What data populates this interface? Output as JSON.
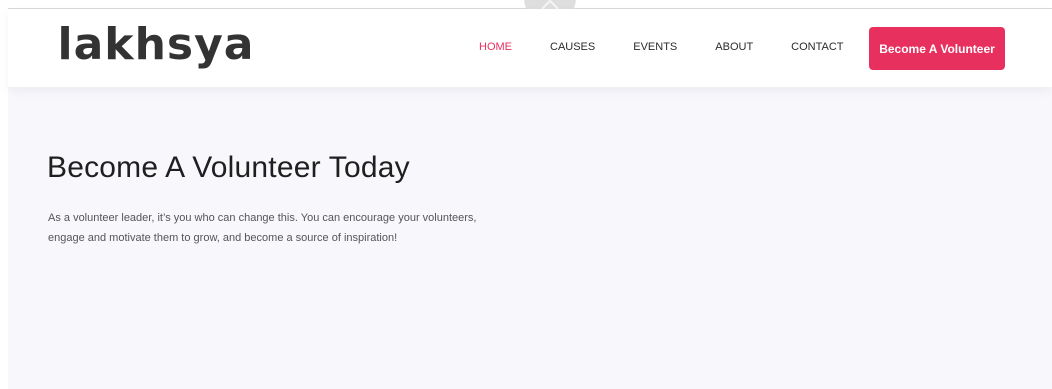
{
  "header": {
    "logo_text": "lakhsya",
    "nav": [
      {
        "label": "HOME",
        "active": true
      },
      {
        "label": "CAUSES",
        "active": false
      },
      {
        "label": "EVENTS",
        "active": false
      },
      {
        "label": "ABOUT",
        "active": false
      },
      {
        "label": "CONTACT",
        "active": false
      }
    ],
    "cta_label": "Become A Volunteer"
  },
  "hero": {
    "title": "Become A Volunteer Today",
    "text_line1": "As a volunteer leader, it’s you who can change this. You can encourage your volunteers,",
    "text_line2": "engage and motivate them to grow, and become a source of inspiration!"
  },
  "icons": {
    "scroll_top": "chevron-up-icon"
  },
  "colors": {
    "accent": "#e8305e",
    "hero_background": "#f8f7fc",
    "text_dark": "#1f1f1f"
  }
}
